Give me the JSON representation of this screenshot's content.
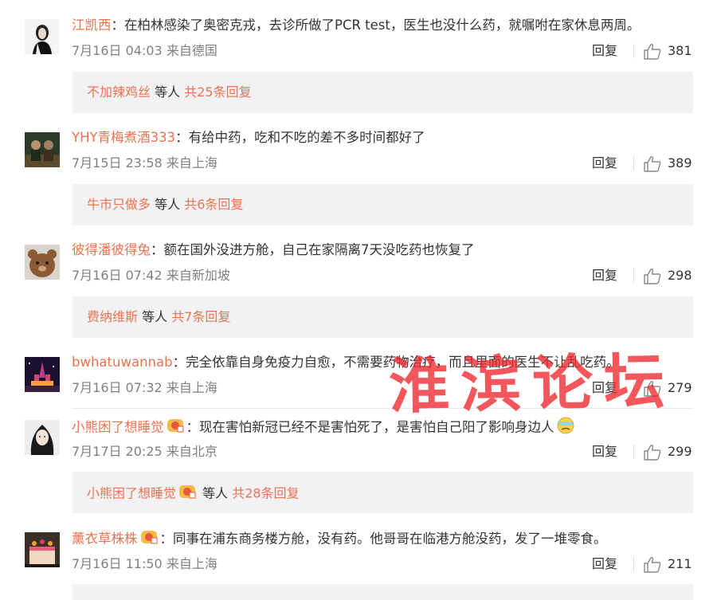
{
  "comments": [
    {
      "user": "江凯西",
      "sep": "：",
      "text": "在柏林感染了奥密克戎，去诊所做了PCR test，医生也没什么药，就嘱咐在家休息两周。",
      "meta": "7月16日 04:03 来自德国",
      "reply_label": "回复",
      "likes": "381",
      "replies": {
        "name": "不加辣鸡丝",
        "deng": "等人",
        "count": "共25条回复"
      }
    },
    {
      "user": "YHY青梅煮酒333",
      "sep": "：",
      "text": "有给中药，吃和不吃的差不多时间都好了",
      "meta": "7月15日 23:58 来自上海",
      "reply_label": "回复",
      "likes": "389",
      "replies": {
        "name": "牛市只做多",
        "deng": "等人",
        "count": "共6条回复"
      }
    },
    {
      "user": "彼得潘彼得兔",
      "sep": "：",
      "text": "额在国外没进方舱，自己在家隔离7天没吃药也恢复了",
      "meta": "7月16日 07:42 来自新加坡",
      "reply_label": "回复",
      "likes": "298",
      "replies": {
        "name": "费纳维斯",
        "deng": "等人",
        "count": "共7条回复"
      }
    },
    {
      "user": "bwhatuwannab",
      "sep": "：",
      "text": "完全依靠自身免疫力自愈，不需要药物治疗，而且里面的医生不让乱吃药。",
      "meta": "7月16日 07:32 来自上海",
      "reply_label": "回复",
      "likes": "279"
    },
    {
      "user": "小熊困了想睡觉",
      "sep": "：",
      "text": "现在害怕新冠已经不是害怕死了，是害怕自己阳了影响身边人",
      "meta": "7月17日 20:25 来自北京",
      "reply_label": "回复",
      "likes": "299",
      "replies": {
        "name": "小熊困了想睡觉",
        "deng": "等人",
        "count": "共28条回复"
      }
    },
    {
      "user": "薰衣草株株",
      "sep": "：",
      "text": "同事在浦东商务楼方舱，没有药。他哥哥在临港方舱没药，发了一堆零食。",
      "meta": "7月16日 11:50 来自上海",
      "reply_label": "回复",
      "likes": "211"
    }
  ],
  "watermark": "淮滨论坛",
  "colors": {
    "username": "#eb7350",
    "reply_bg": "#f2f2f5",
    "meta": "#808080",
    "watermark": "#ee282d"
  }
}
